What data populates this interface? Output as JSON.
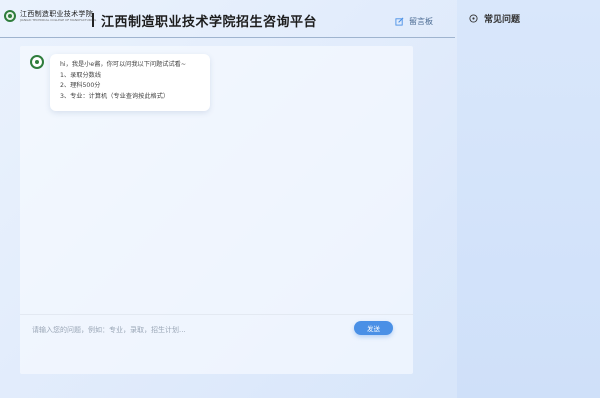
{
  "header": {
    "logo_cn": "江西制造职业技术学院",
    "logo_en": "JIANGXI TECHNICAL COLLEGE OF MANUFACTURING",
    "title": "江西制造职业技术学院招生咨询平台",
    "guestbook_label": "留言板"
  },
  "chat": {
    "bot_message_lines": [
      "hi，我是小e酱，你可以问我以下问题试试看~",
      "1、录取分数线",
      "2、理科500分",
      "3、专业：计算机（专业查询按此格式）"
    ],
    "input_placeholder": "请输入您的问题，例如：专业，录取，招生计划...",
    "send_label": "发送"
  },
  "sidebar": {
    "faq_title": "常见问题"
  },
  "colors": {
    "accent": "#4a90e6",
    "logo_green": "#2f7d3c"
  },
  "icons": {
    "guestbook": "edit-icon",
    "faq": "question-circle-icon"
  }
}
